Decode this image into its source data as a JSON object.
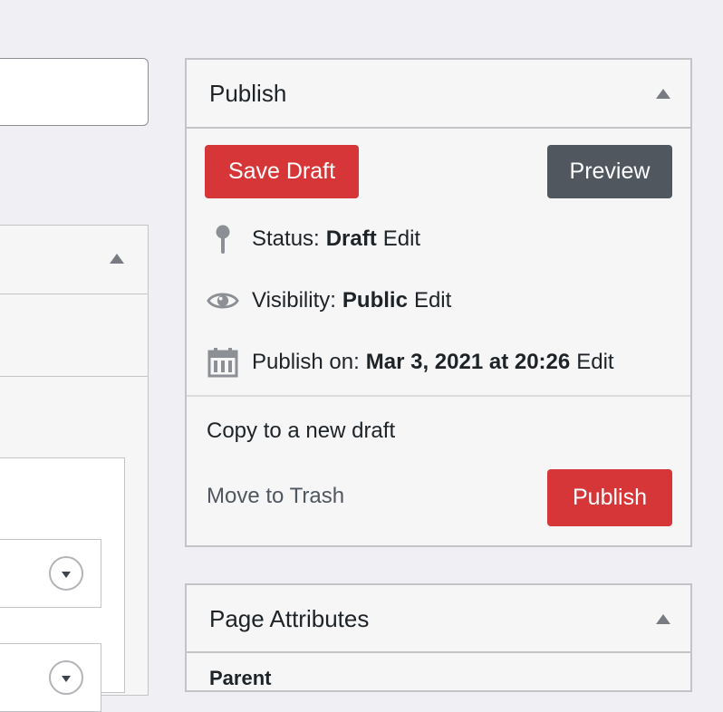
{
  "publish": {
    "title": "Publish",
    "save_draft": "Save Draft",
    "preview": "Preview",
    "status_label": "Status:",
    "status_value": "Draft",
    "visibility_label": "Visibility:",
    "visibility_value": "Public",
    "publish_on_label": "Publish on:",
    "publish_on_value": "Mar 3, 2021 at 20:26",
    "edit": "Edit",
    "copy_to_draft": "Copy to a new draft",
    "move_to_trash": "Move to Trash",
    "publish_button": "Publish"
  },
  "page_attributes": {
    "title": "Page Attributes",
    "parent_label": "Parent"
  },
  "colors": {
    "primary_red": "#d63638",
    "dark_button": "#50575e",
    "background": "#f0f0f4",
    "border": "#c3c4c7"
  },
  "icons": [
    "pin-icon",
    "eye-icon",
    "calendar-icon",
    "collapse-arrow-icon",
    "dropdown-icon"
  ]
}
